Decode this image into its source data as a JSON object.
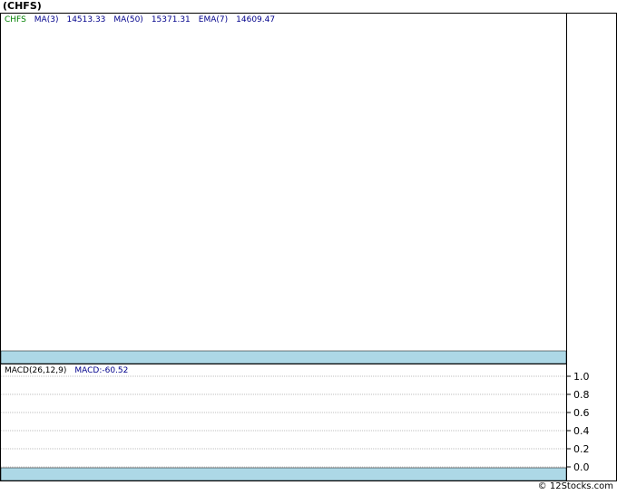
{
  "title": "(CHFS)",
  "footer": "© 12Stocks.com",
  "colors": {
    "band": "#add8e6",
    "symbol": "#008000",
    "indicator": "#00008b",
    "grid": "#808080"
  },
  "chart_data": [
    {
      "type": "line",
      "symbol": "CHFS",
      "legend": [
        {
          "label": "CHFS"
        },
        {
          "label": "MA(3)",
          "value": "14513.33"
        },
        {
          "label": "MA(50)",
          "value": "15371.31"
        },
        {
          "label": "EMA(7)",
          "value": "14609.47"
        }
      ],
      "series": []
    },
    {
      "type": "line",
      "legend": [
        {
          "label": "MACD(26,12,9)"
        },
        {
          "label": "MACD:",
          "value": "-60.52"
        }
      ],
      "y_ticks": [
        "1.0",
        "0.8",
        "0.6",
        "0.4",
        "0.2",
        "0.0"
      ],
      "ylim": [
        0,
        1
      ],
      "grid": true,
      "series": []
    }
  ]
}
